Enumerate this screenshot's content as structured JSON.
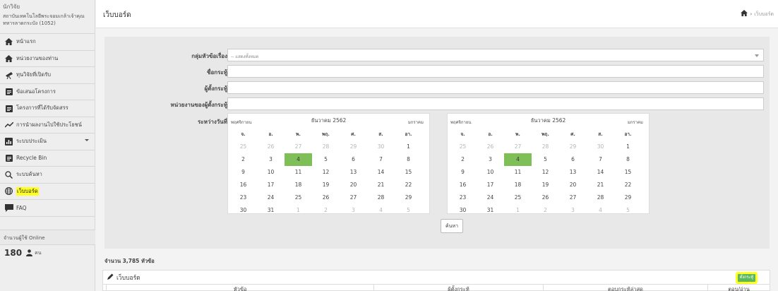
{
  "sidebar": {
    "user_role": "นักวิจัย",
    "user_org": "สถาบันเทคโนโลยีพระจอมเกล้าเจ้าคุณทหารลาดกระบัง (1052)",
    "items": [
      {
        "label": "หน้าแรก",
        "icon": "home-icon"
      },
      {
        "label": "หน่วยงานของท่าน",
        "icon": "home-icon"
      },
      {
        "label": "ทุนวิจัยที่เปิดรับ",
        "icon": "telescope-icon"
      },
      {
        "label": "ข้อเสนอโครงการ",
        "icon": "clipboard-icon"
      },
      {
        "label": "โครงการที่ได้รับจัดสรร",
        "icon": "clipboard-icon"
      },
      {
        "label": "การนำผลงานไปใช้ประโยชน์",
        "icon": "trend-icon"
      },
      {
        "label": "ระบบประเมิน",
        "icon": "chart-icon"
      },
      {
        "label": "Recycle Bin",
        "icon": "clipboard-icon"
      },
      {
        "label": "ระบบค้นหา",
        "icon": "search-icon"
      },
      {
        "label": "เว็บบอร์ด",
        "icon": "globe-icon"
      },
      {
        "label": "FAQ",
        "icon": "comment-icon"
      }
    ],
    "online_title": "จำนวนผู้ใช้ Online",
    "online_count": "180",
    "online_unit": "คน"
  },
  "header": {
    "title": "เว็บบอร์ด",
    "breadcrumb": "เว็บบอร์ด"
  },
  "form": {
    "group_label": "กลุ่มหัวข้อเรื่อง",
    "group_value": "-- แสดงทั้งหมด",
    "name_label": "ชื่อกระทู้",
    "author_label": "ผู้ตั้งกระทู้",
    "unit_label": "หน่วยงานของผู้ตั้งกระทู้",
    "date_label": "ระหว่างวันที่",
    "search_button": "ค้นหา"
  },
  "calendar": {
    "prev": "พฤศจิกายน",
    "title": "ธันวาคม 2562",
    "next": "มกราคม",
    "weekdays": [
      "จ.",
      "อ.",
      "พ.",
      "พฤ.",
      "ศ.",
      "ส.",
      "อา."
    ],
    "weeks": [
      [
        "25",
        "26",
        "27",
        "28",
        "29",
        "30",
        "1"
      ],
      [
        "2",
        "3",
        "4",
        "5",
        "6",
        "7",
        "8"
      ],
      [
        "9",
        "10",
        "11",
        "12",
        "13",
        "14",
        "15"
      ],
      [
        "16",
        "17",
        "18",
        "19",
        "20",
        "21",
        "22"
      ],
      [
        "23",
        "24",
        "25",
        "26",
        "27",
        "28",
        "29"
      ],
      [
        "30",
        "31",
        "1",
        "2",
        "3",
        "4",
        "5"
      ]
    ],
    "other_month": [
      [
        true,
        true,
        true,
        true,
        true,
        true,
        false
      ],
      [
        false,
        false,
        false,
        false,
        false,
        false,
        false
      ],
      [
        false,
        false,
        false,
        false,
        false,
        false,
        false
      ],
      [
        false,
        false,
        false,
        false,
        false,
        false,
        false
      ],
      [
        false,
        false,
        false,
        false,
        false,
        false,
        false
      ],
      [
        false,
        false,
        true,
        true,
        true,
        true,
        true
      ]
    ],
    "selected_day": "4"
  },
  "results": {
    "count_text": "จำนวน 3,785 หัวข้อ",
    "panel_title": "เว็บบอร์ด",
    "new_topic_button": "ตั้งกระทู้",
    "columns": [
      "หัวข้อ",
      "ผู้ตั้งกระทู้",
      "ตอบกระทู้ล่าสุด",
      "ตอบ/อ่าน"
    ]
  }
}
